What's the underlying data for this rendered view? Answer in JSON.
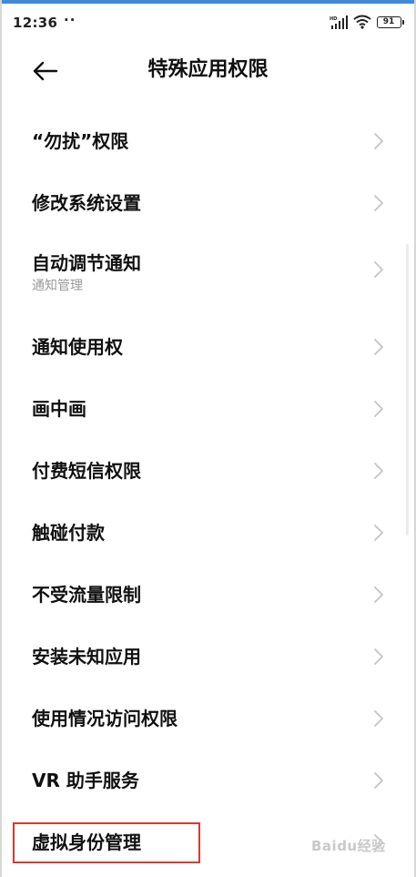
{
  "status_bar": {
    "time": "12:36",
    "dots": "··",
    "battery": "91",
    "icons": [
      "hd-signal-icon",
      "wifi-icon",
      "battery-icon"
    ]
  },
  "header": {
    "title": "特殊应用权限",
    "back_icon": "back-arrow-icon"
  },
  "items": [
    {
      "title": "“勿扰”权限",
      "subtitle": ""
    },
    {
      "title": "修改系统设置",
      "subtitle": ""
    },
    {
      "title": "自动调节通知",
      "subtitle": "通知管理"
    },
    {
      "title": "通知使用权",
      "subtitle": ""
    },
    {
      "title": "画中画",
      "subtitle": ""
    },
    {
      "title": "付费短信权限",
      "subtitle": ""
    },
    {
      "title": "触碰付款",
      "subtitle": ""
    },
    {
      "title": "不受流量限制",
      "subtitle": ""
    },
    {
      "title": "安装未知应用",
      "subtitle": ""
    },
    {
      "title": "使用情况访问权限",
      "subtitle": ""
    },
    {
      "title": "VR 助手服务",
      "subtitle": ""
    },
    {
      "title": "虚拟身份管理",
      "subtitle": ""
    }
  ],
  "colors": {
    "accent_top": "#3c8bd9",
    "highlight": "#d9392f",
    "subtitle": "#999999",
    "chevron": "#c4c4c4"
  },
  "watermark": "Baidu经验"
}
